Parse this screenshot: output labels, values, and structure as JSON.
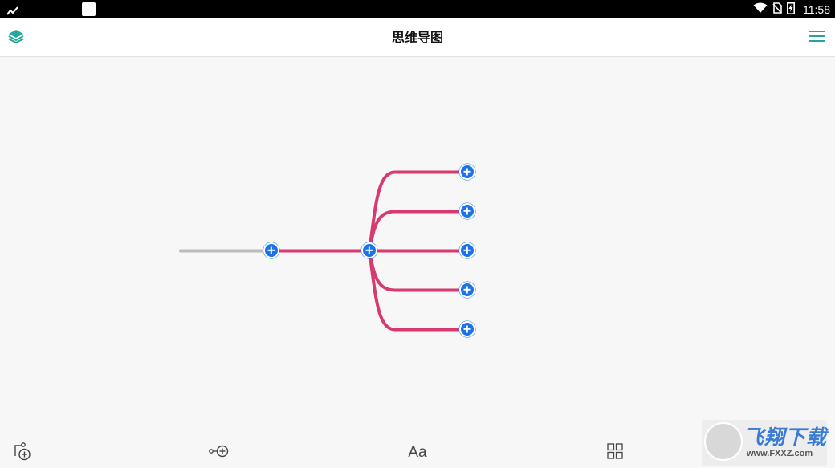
{
  "status_bar": {
    "time": "11:58",
    "icons": [
      "activity-icon",
      "notification-square-icon",
      "wifi-icon",
      "no-sim-icon",
      "battery-charging-icon"
    ]
  },
  "app_bar": {
    "title": "思维导图",
    "left_icon": "layers-icon",
    "right_icon": "hamburger-menu-icon",
    "accent_color": "#26a69a"
  },
  "mind_map": {
    "root_line_color": "#bbbbbb",
    "branch_color": "#d63a6e",
    "node_button_color": "#1a73e8",
    "child_branch_count": 5
  },
  "toolbar": {
    "buttons": [
      {
        "name": "add-topic-button",
        "icon": "add-topic-icon"
      },
      {
        "name": "add-subtopic-button",
        "icon": "add-subtopic-icon"
      },
      {
        "name": "text-style-button",
        "label": "Aa"
      },
      {
        "name": "layout-button",
        "icon": "grid-icon"
      }
    ]
  },
  "watermark": {
    "main_text": "飞翔下载",
    "sub_text": "www.FXXZ.com"
  }
}
